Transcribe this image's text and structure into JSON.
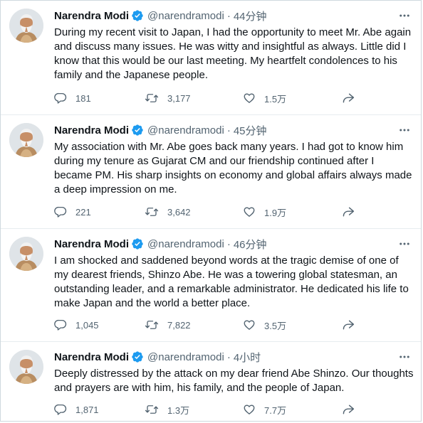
{
  "tweets": [
    {
      "name": "Narendra Modi",
      "handle": "@narendramodi",
      "separator": "·",
      "time": "44分钟",
      "text": "During my recent visit to Japan, I had the opportunity to meet Mr. Abe again and discuss many issues. He was witty and insightful as always. Little did I know that this would be our last meeting. My heartfelt condolences to his family and the Japanese people.",
      "replies": "181",
      "retweets": "3,177",
      "likes": "1.5万"
    },
    {
      "name": "Narendra Modi",
      "handle": "@narendramodi",
      "separator": "·",
      "time": "45分钟",
      "text": "My association with Mr. Abe goes back many years. I had got to know him during my tenure as Gujarat CM and our friendship continued after I became PM. His sharp insights on economy and global affairs always made a deep impression on me.",
      "replies": "221",
      "retweets": "3,642",
      "likes": "1.9万"
    },
    {
      "name": "Narendra Modi",
      "handle": "@narendramodi",
      "separator": "·",
      "time": "46分钟",
      "text": "I am shocked and saddened beyond words at the tragic demise of one of my dearest friends, Shinzo Abe. He was a towering global statesman, an outstanding leader, and a remarkable administrator. He dedicated his life to make Japan and the world a better place.",
      "replies": "1,045",
      "retweets": "7,822",
      "likes": "3.5万"
    },
    {
      "name": "Narendra Modi",
      "handle": "@narendramodi",
      "separator": "·",
      "time": "4小时",
      "text": "Deeply distressed by the attack on my dear friend Abe Shinzo. Our thoughts and prayers are with him, his family, and the people of Japan.",
      "replies": "1,871",
      "retweets": "1.3万",
      "likes": "7.7万"
    }
  ],
  "icons": {
    "verified": "verified-badge-icon",
    "more": "more-horizontal-icon",
    "reply": "reply-icon",
    "retweet": "retweet-icon",
    "like": "heart-icon",
    "share": "share-icon"
  },
  "colors": {
    "verified_blue": "#1d9bf0",
    "text_primary": "#0f1419",
    "text_secondary": "#536471",
    "divider": "#e7ecef"
  }
}
